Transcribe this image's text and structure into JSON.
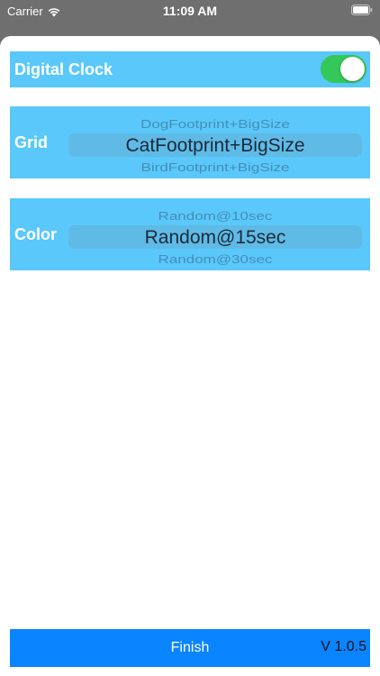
{
  "status_bar": {
    "carrier": "Carrier",
    "time": "11:09 AM"
  },
  "settings": {
    "digital_clock": {
      "label": "Digital Clock",
      "enabled": true
    },
    "grid": {
      "label": "Grid",
      "options_visible": {
        "previous": "DogFootprint+BigSize",
        "selected": "CatFootprint+BigSize",
        "next": "BirdFootprint+BigSize"
      }
    },
    "color": {
      "label": "Color",
      "options_visible": {
        "previous": "Random@10sec",
        "selected": "Random@15sec",
        "next": "Random@30sec"
      }
    }
  },
  "footer": {
    "finish_label": "Finish",
    "version": "V 1.0.5"
  },
  "colors": {
    "row_background": "#5ac8fa",
    "toggle_on": "#34c759",
    "finish_background": "#0a84ff"
  }
}
